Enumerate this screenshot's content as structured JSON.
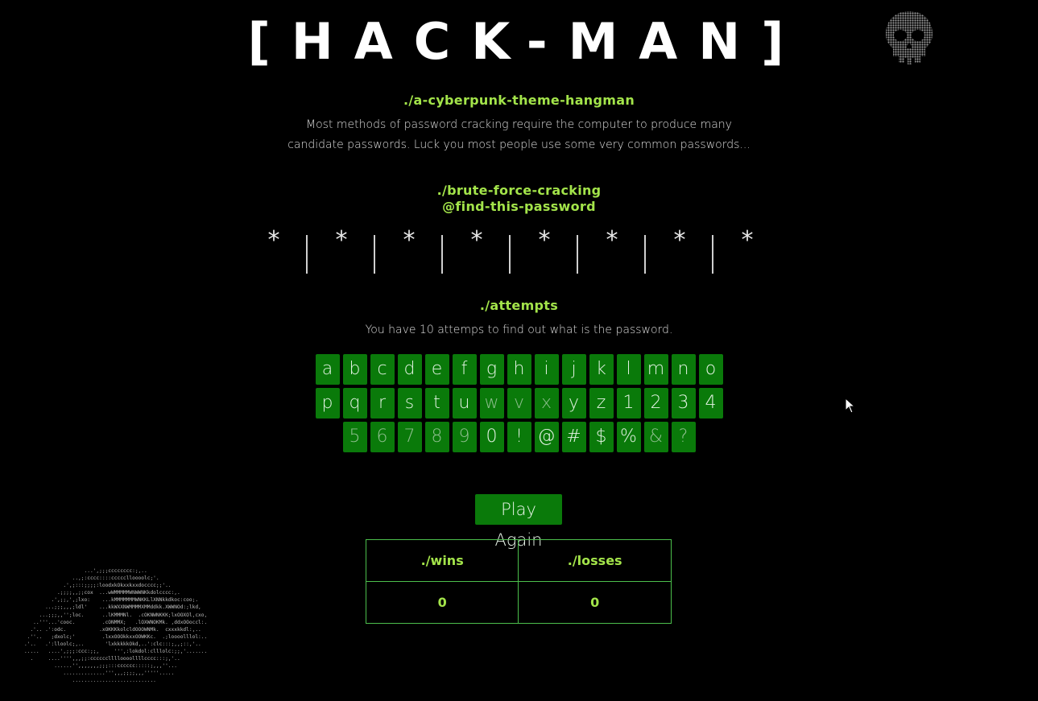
{
  "header": {
    "title": "[HACK-MAN]",
    "skull_icon": "skull-icon"
  },
  "intro": {
    "heading": "./a-cyberpunk-theme-hangman",
    "text_line1": "Most methods of password cracking require the computer to produce many",
    "text_line2": "candidate passwords. Luck you most people use some very common passwords..."
  },
  "password": {
    "heading_line1": "./brute-force-cracking",
    "heading_line2": "@find-this-password",
    "slots": [
      "*",
      "*",
      "*",
      "*",
      "*",
      "*",
      "*",
      "*"
    ]
  },
  "attempts": {
    "heading": "./attempts",
    "text": "You have 10 attemps to find out what is the password."
  },
  "keyboard": {
    "rows": [
      [
        "a",
        "b",
        "c",
        "d",
        "e",
        "f",
        "g",
        "h",
        "i",
        "j",
        "k",
        "l",
        "m",
        "n",
        "o"
      ],
      [
        "p",
        "q",
        "r",
        "s",
        "t",
        "u",
        "w",
        "v",
        "x",
        "y",
        "z",
        "1",
        "2",
        "3",
        "4"
      ],
      [
        "5",
        "6",
        "7",
        "8",
        "9",
        "0",
        "!",
        "@",
        "#",
        "$",
        "%",
        "&",
        "?"
      ]
    ]
  },
  "play_again_label": "Play Again",
  "scores": {
    "wins_label": "./wins",
    "losses_label": "./losses",
    "wins": "0",
    "losses": "0"
  },
  "colors": {
    "accent_green": "#a3e44a",
    "key_green": "#0a7a0a",
    "table_border": "#4cbf4c"
  }
}
